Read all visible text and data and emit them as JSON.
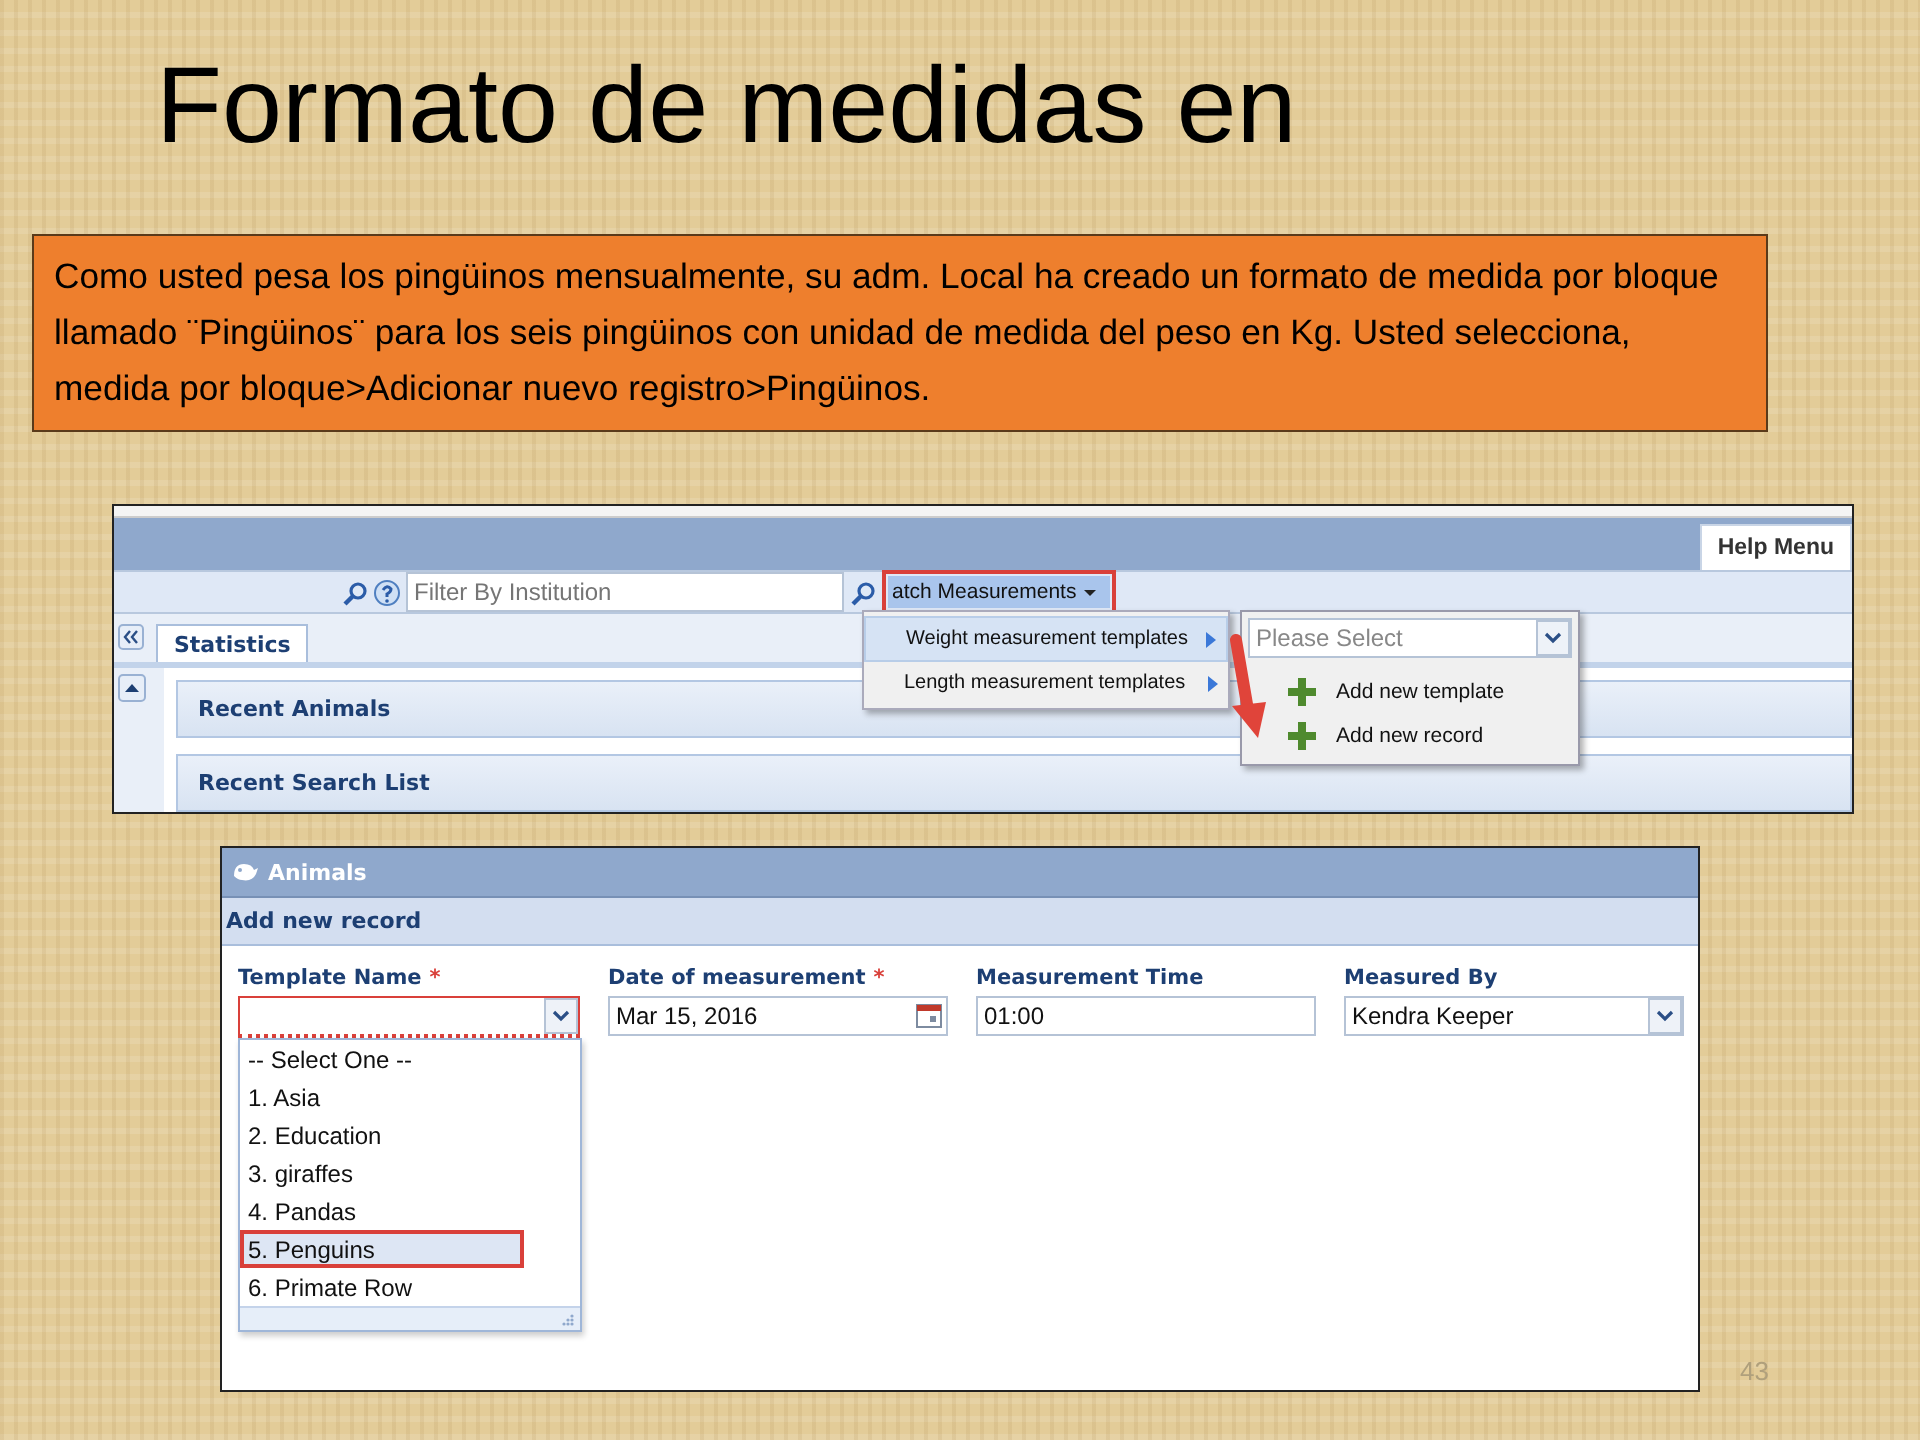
{
  "slide": {
    "title": "Formato de medidas en",
    "note": "Como usted pesa los pingüinos mensualmente, su adm. Local ha creado un formato de medida por bloque llamado ¨Pingüinos¨ para los seis pingüinos con unidad de medida del peso en Kg. Usted selecciona, medida por bloque>Adicionar nuevo registro>Pingüinos.",
    "page_number": "43"
  },
  "screenshot_top": {
    "help_menu": "Help Menu",
    "filter_placeholder": "Filter By Institution",
    "menu_button": "atch Measurements",
    "tabs": [
      {
        "label": "Statistics",
        "selected": true
      }
    ],
    "panels": [
      "Recent Animals",
      "Recent Search List"
    ],
    "menu": [
      {
        "label": "Weight measurement templates",
        "selected": true
      },
      {
        "label": "Length measurement templates",
        "selected": false
      }
    ],
    "submenu": {
      "select_placeholder": "Please Select",
      "items": [
        "Add new template",
        "Add new record"
      ]
    }
  },
  "screenshot_form": {
    "title": "Animals",
    "subtitle": "Add new record",
    "fields": [
      {
        "kind": "combo",
        "label": "Template Name",
        "required_mark": "*",
        "invalid": true
      },
      {
        "kind": "date",
        "label": "Date of measurement",
        "required_mark": "*",
        "value": "Mar 15, 2016",
        "invalid": false
      },
      {
        "kind": "text",
        "label": "Measurement Time",
        "value": "01:00",
        "invalid": false
      },
      {
        "kind": "combo",
        "label": "Measured By",
        "value": "Kendra Keeper",
        "invalid": false
      }
    ],
    "dropdown": [
      {
        "label": "-- Select One --",
        "selected": false
      },
      {
        "label": "1. Asia",
        "selected": false
      },
      {
        "label": "2. Education",
        "selected": false
      },
      {
        "label": "3. giraffes",
        "selected": false
      },
      {
        "label": "4. Pandas",
        "selected": false
      },
      {
        "label": "5. Penguins",
        "selected": true
      },
      {
        "label": "6. Primate Row",
        "selected": false
      }
    ]
  }
}
